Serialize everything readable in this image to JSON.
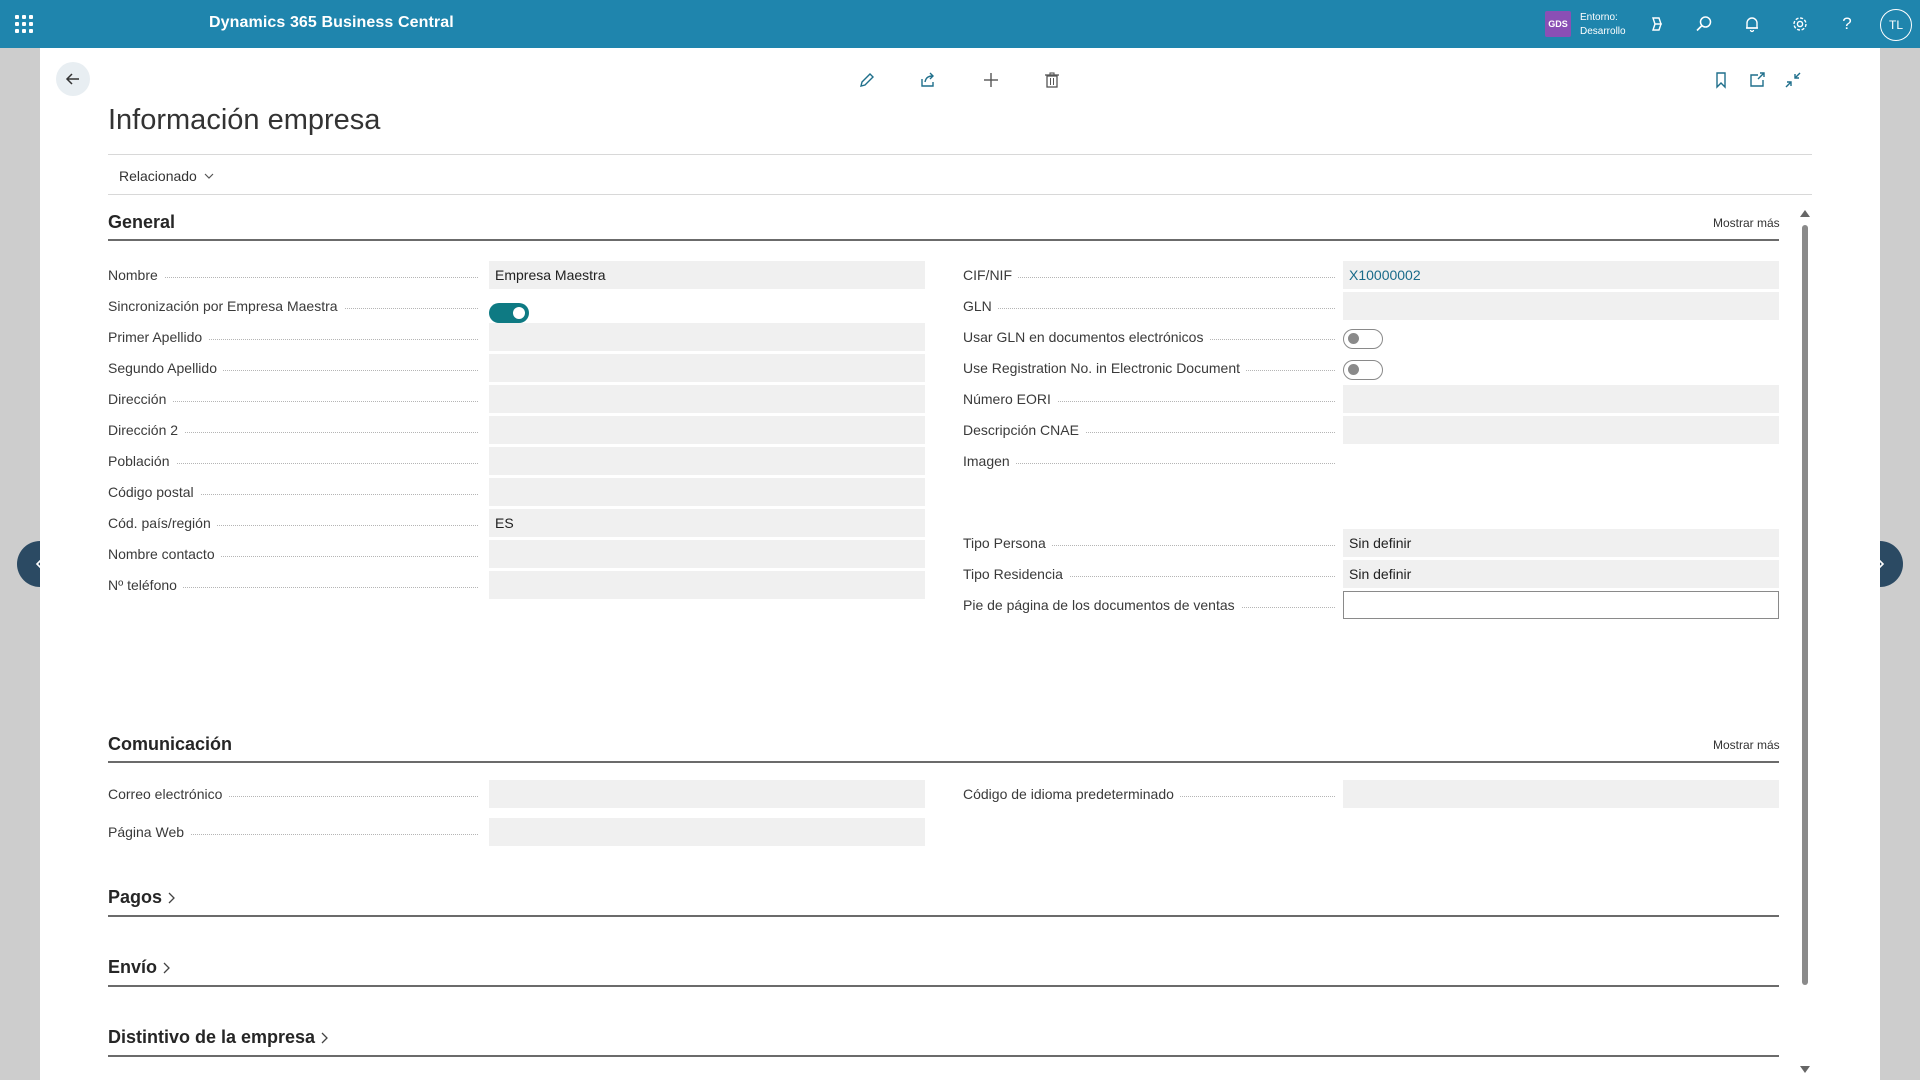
{
  "header": {
    "app_title": "Dynamics 365 Business Central",
    "env_badge": "GDS",
    "env_label": "Entorno:",
    "env_name": "Desarrollo",
    "avatar_initials": "TL"
  },
  "page": {
    "title": "Información empresa",
    "related_label": "Relacionado"
  },
  "general": {
    "title": "General",
    "show_more": "Mostrar más",
    "left_fields": [
      {
        "label": "Nombre",
        "value": "Empresa Maestra"
      },
      {
        "label": "Sincronización por Empresa Maestra",
        "toggle": "on"
      },
      {
        "label": "Primer Apellido",
        "value": ""
      },
      {
        "label": "Segundo Apellido",
        "value": ""
      },
      {
        "label": "Dirección",
        "value": ""
      },
      {
        "label": "Dirección 2",
        "value": ""
      },
      {
        "label": "Población",
        "value": ""
      },
      {
        "label": "Código postal",
        "value": ""
      },
      {
        "label": "Cód. país/región",
        "value": "ES"
      },
      {
        "label": "Nombre contacto",
        "value": ""
      },
      {
        "label": "Nº teléfono",
        "value": ""
      }
    ],
    "right_fields": [
      {
        "label": "CIF/NIF",
        "value": "X10000002"
      },
      {
        "label": "GLN",
        "value": ""
      },
      {
        "label": "Usar GLN en documentos electrónicos",
        "toggle": "off"
      },
      {
        "label": "Use Registration No. in Electronic Document",
        "toggle": "off"
      },
      {
        "label": "Número EORI",
        "value": ""
      },
      {
        "label": "Descripción CNAE",
        "value": ""
      },
      {
        "label": "Imagen"
      },
      {
        "label": "Tipo Persona",
        "value": "Sin definir"
      },
      {
        "label": "Tipo Residencia",
        "value": "Sin definir"
      },
      {
        "label": "Pie de página de los documentos de ventas",
        "value": ""
      }
    ]
  },
  "communication": {
    "title": "Comunicación",
    "show_more": "Mostrar más",
    "left_fields": [
      {
        "label": "Correo electrónico",
        "value": ""
      },
      {
        "label": "Página Web",
        "value": ""
      }
    ],
    "right_fields": [
      {
        "label": "Código de idioma predeterminado",
        "value": ""
      }
    ]
  },
  "sections": {
    "payments": "Pagos",
    "shipping": "Envío",
    "branding": "Distintivo de la empresa"
  },
  "colors": {
    "topbar": "#1f85ad",
    "toggle_on": "#0e7a83",
    "env_badge": "#8a4fb5",
    "link_value": "#1a6b8a"
  }
}
